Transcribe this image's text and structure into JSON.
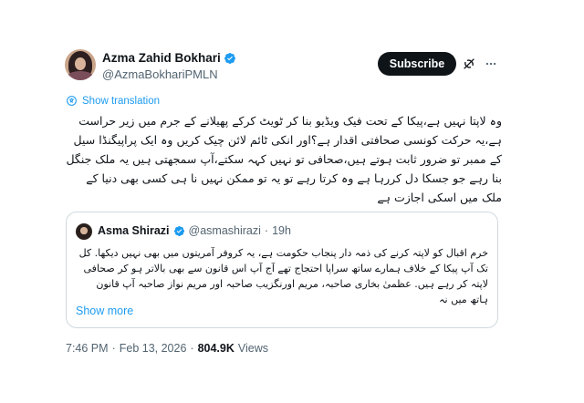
{
  "author": {
    "name": "Azma Zahid Bokhari",
    "handle": "@AzmaBokhariPMLN",
    "verified_color": "#1d9bf0"
  },
  "actions": {
    "subscribe_label": "Subscribe",
    "grok_icon": "grok-icon",
    "more_icon": "more-dots-icon"
  },
  "translate": {
    "label": "Show translation",
    "icon": "translate-icon"
  },
  "tweet_text": "وہ لاپتا نہیں ہے،پیکا کے تحت فیک ویڈیو بنا کر ٹویٹ کرکے پھیلانے کے جرم میں زیر حراست ہے،یہ حرکت کونسی صحافتی اقدار ہے؟اور انکی ٹائم لائن چیک کریں وہ ایک پراپیگنڈا سیل کے ممبر تو ضرور ثابت ہوتے ہیں،صحافی تو نہیں کہہ سکتے،آپ سمجھتی ہیں یہ ملک جنگل بنا رہے جو جسکا دل کررہا ہے وہ کرتا رہے تو یہ تو ممکن نہیں نا ہی کسی بھی دنیا کے ملک میں اسکی اجازت ہے",
  "quote": {
    "name": "Asma Shirazi",
    "handle": "@asmashirazi",
    "separator": "·",
    "time": "19h",
    "text": "خرم اقبال کو لاپتہ کرنے کی ذمہ دار پنجاب حکومت ہے، یہ کروفر آمریتوں میں بھی نہیں دیکھا. کل تک آپ پیکا کے خلاف ہمارے ساتھ سراپا احتجاج تھے آج آپ اس قانون سے بھی بالاتر ہو کر صحافی لاپتہ کر رہے ہیں. عظمیٰ بخاری صاحبہ، مریم اورنگزیب صاحبہ اور مریم نواز صاحبہ آپ قانون ہاتھ میں نہ",
    "show_more": "Show more"
  },
  "meta": {
    "time": "7:46 PM",
    "sep1": "·",
    "date": "Feb 13, 2026",
    "sep2": "·",
    "views_count": "804.9K",
    "views_label": "Views"
  }
}
